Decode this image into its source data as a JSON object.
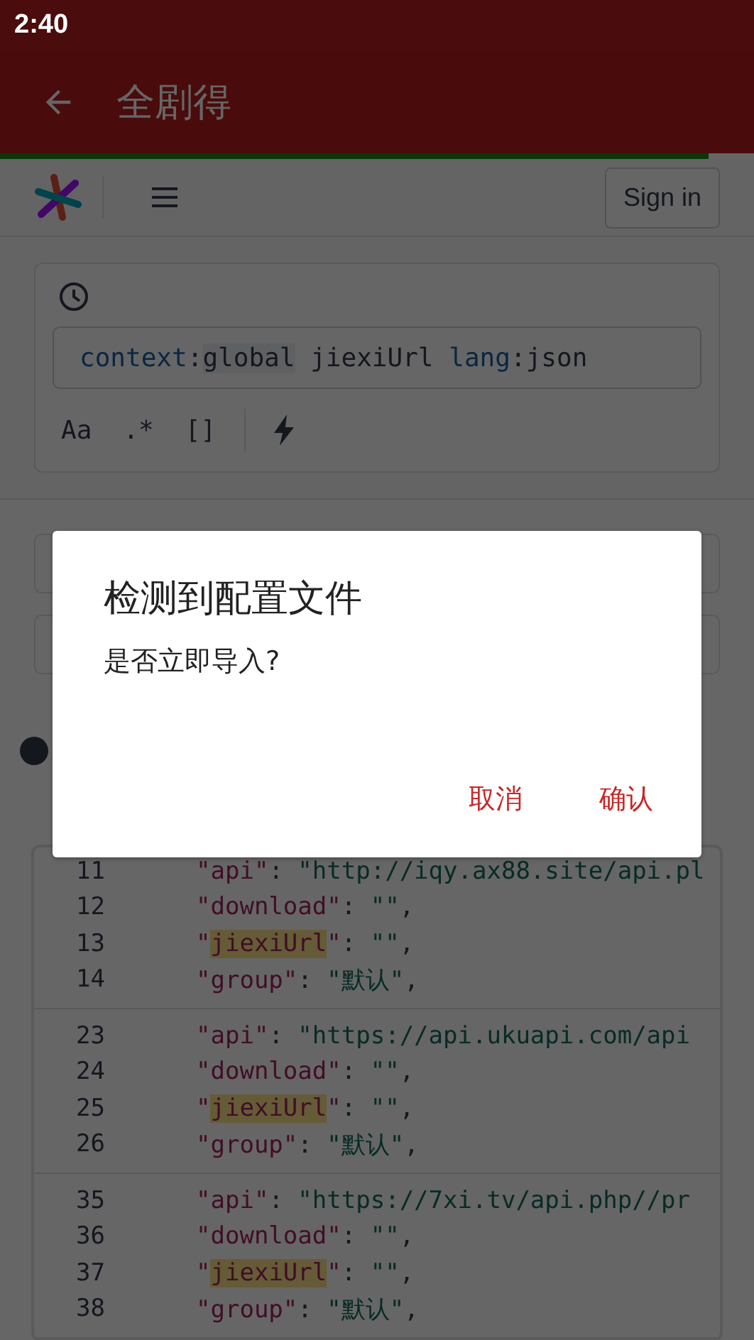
{
  "status_bar": {
    "time": "2:40"
  },
  "toolbar": {
    "title": "全剧得"
  },
  "page_progress": {
    "level": 0.94
  },
  "site_header": {
    "sign_in": "Sign in"
  },
  "search": {
    "query": [
      {
        "kind": "filter",
        "text": "context"
      },
      {
        "kind": "punct",
        "text": ":"
      },
      {
        "kind": "value",
        "text": "global"
      },
      {
        "kind": "plain",
        "text": " jiexiUrl "
      },
      {
        "kind": "filter",
        "text": "lang"
      },
      {
        "kind": "punct",
        "text": ":"
      },
      {
        "kind": "plain",
        "text": "json"
      }
    ],
    "options": [
      {
        "kind": "text",
        "label": "Aa"
      },
      {
        "kind": "text",
        "label": ".*"
      },
      {
        "kind": "text",
        "label": "[]"
      },
      {
        "kind": "divider"
      },
      {
        "kind": "lightning"
      }
    ]
  },
  "results": [
    [
      {
        "number": "11",
        "tokens": [
          {
            "kind": "key",
            "text": "\"api\""
          },
          {
            "kind": "punct",
            "text": ": "
          },
          {
            "kind": "string",
            "text": "\"http://iqy.ax88.site/api.pl"
          }
        ]
      },
      {
        "number": "12",
        "tokens": [
          {
            "kind": "key",
            "text": "\"download\""
          },
          {
            "kind": "punct",
            "text": ": "
          },
          {
            "kind": "string",
            "text": "\"\""
          },
          {
            "kind": "punct",
            "text": ","
          }
        ]
      },
      {
        "number": "13",
        "tokens": [
          {
            "kind": "key",
            "text": "\""
          },
          {
            "kind": "match",
            "text": "jiexiUrl"
          },
          {
            "kind": "key",
            "text": "\""
          },
          {
            "kind": "punct",
            "text": ": "
          },
          {
            "kind": "string",
            "text": "\"\""
          },
          {
            "kind": "punct",
            "text": ","
          }
        ]
      },
      {
        "number": "14",
        "tokens": [
          {
            "kind": "key",
            "text": "\"group\""
          },
          {
            "kind": "punct",
            "text": ": "
          },
          {
            "kind": "string",
            "text": "\"默认\""
          },
          {
            "kind": "punct",
            "text": ","
          }
        ]
      }
    ],
    [
      {
        "number": "23",
        "tokens": [
          {
            "kind": "key",
            "text": "\"api\""
          },
          {
            "kind": "punct",
            "text": ": "
          },
          {
            "kind": "string",
            "text": "\"https://api.ukuapi.com/api"
          }
        ]
      },
      {
        "number": "24",
        "tokens": [
          {
            "kind": "key",
            "text": "\"download\""
          },
          {
            "kind": "punct",
            "text": ": "
          },
          {
            "kind": "string",
            "text": "\"\""
          },
          {
            "kind": "punct",
            "text": ","
          }
        ]
      },
      {
        "number": "25",
        "tokens": [
          {
            "kind": "key",
            "text": "\""
          },
          {
            "kind": "match",
            "text": "jiexiUrl"
          },
          {
            "kind": "key",
            "text": "\""
          },
          {
            "kind": "punct",
            "text": ": "
          },
          {
            "kind": "string",
            "text": "\"\""
          },
          {
            "kind": "punct",
            "text": ","
          }
        ]
      },
      {
        "number": "26",
        "tokens": [
          {
            "kind": "key",
            "text": "\"group\""
          },
          {
            "kind": "punct",
            "text": ": "
          },
          {
            "kind": "string",
            "text": "\"默认\""
          },
          {
            "kind": "punct",
            "text": ","
          }
        ]
      }
    ],
    [
      {
        "number": "35",
        "tokens": [
          {
            "kind": "key",
            "text": "\"api\""
          },
          {
            "kind": "punct",
            "text": ": "
          },
          {
            "kind": "string",
            "text": "\"https://7xi.tv/api.php//pr"
          }
        ]
      },
      {
        "number": "36",
        "tokens": [
          {
            "kind": "key",
            "text": "\"download\""
          },
          {
            "kind": "punct",
            "text": ": "
          },
          {
            "kind": "string",
            "text": "\"\""
          },
          {
            "kind": "punct",
            "text": ","
          }
        ]
      },
      {
        "number": "37",
        "tokens": [
          {
            "kind": "key",
            "text": "\""
          },
          {
            "kind": "match",
            "text": "jiexiUrl"
          },
          {
            "kind": "key",
            "text": "\""
          },
          {
            "kind": "punct",
            "text": ": "
          },
          {
            "kind": "string",
            "text": "\"\""
          },
          {
            "kind": "punct",
            "text": ","
          }
        ]
      },
      {
        "number": "38",
        "tokens": [
          {
            "kind": "key",
            "text": "\"group\""
          },
          {
            "kind": "punct",
            "text": ": "
          },
          {
            "kind": "string",
            "text": "\"默认\""
          },
          {
            "kind": "punct",
            "text": ","
          }
        ]
      }
    ]
  ],
  "dialog": {
    "title": "检测到配置文件",
    "message": "是否立即导入?",
    "buttons": [
      "取消",
      "确认"
    ]
  }
}
